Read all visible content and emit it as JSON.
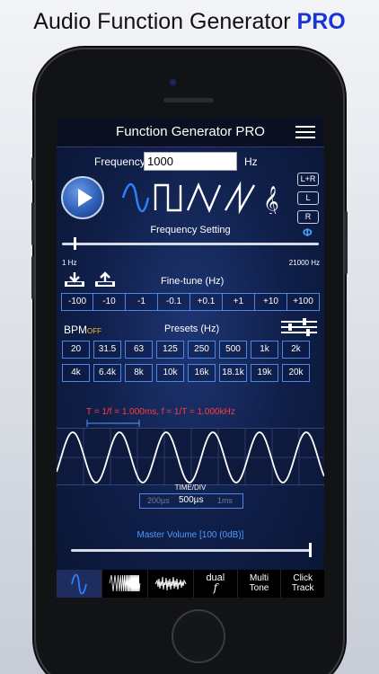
{
  "headline": {
    "text": "Audio Function Generator",
    "accent": "PRO"
  },
  "app": {
    "title": "Function Generator PRO",
    "frequency_label": "Frequency",
    "frequency_value": "1000",
    "frequency_unit": "Hz",
    "channels": [
      "L+R",
      "L",
      "R"
    ],
    "phase_symbol": "Φ",
    "frequency_setting_label": "Frequency Setting",
    "range_min": "1 Hz",
    "range_max": "21000 Hz",
    "frequency_slider_fraction": 0.047,
    "finetune_label": "Fine-tune (Hz)",
    "finetune_buttons": [
      "-100",
      "-10",
      "-1",
      "-0.1",
      "+0.1",
      "+1",
      "+10",
      "+100"
    ],
    "bpm_label": "BPM",
    "bpm_state": "OFF",
    "presets_label": "Presets (Hz)",
    "presets_row1": [
      "20",
      "31.5",
      "63",
      "125",
      "250",
      "500",
      "1k",
      "2k"
    ],
    "presets_row2": [
      "4k",
      "6.4k",
      "8k",
      "10k",
      "16k",
      "18.1k",
      "19k",
      "20k"
    ],
    "formula": "T = 1/f = 1.000ms, f = 1/T = 1.000kHz",
    "timediv_label": "TIME/DIV",
    "timediv_options": [
      "200µs",
      "500µs",
      "1ms"
    ],
    "timediv_selected": "500µs",
    "master_volume_label": "Master Volume [100 (0dB)]",
    "master_volume_fraction": 1.0,
    "tabs": [
      {
        "name": "sine",
        "label": ""
      },
      {
        "name": "sweep",
        "label": ""
      },
      {
        "name": "noise",
        "label": ""
      },
      {
        "name": "dual",
        "line1": "dual",
        "line2": "f"
      },
      {
        "name": "multitone",
        "line1": "Multi",
        "line2": "Tone"
      },
      {
        "name": "clicktrack",
        "line1": "Click",
        "line2": "Track"
      }
    ]
  },
  "colors": {
    "accent_blue": "#4f86e6",
    "waveform_blue": "#2f80ff",
    "formula_red": "#ff3b3b",
    "bpm_off_yellow": "#f0c21a",
    "pro_blue": "#1b33d6"
  }
}
